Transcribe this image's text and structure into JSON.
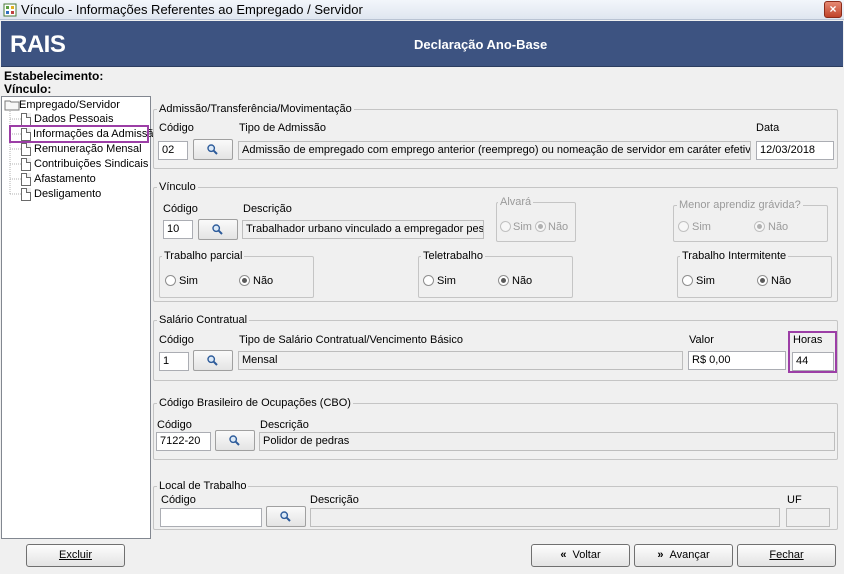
{
  "window": {
    "title": "Vínculo - Informações Referentes ao Empregado / Servidor",
    "close": "×"
  },
  "header": {
    "logo": "RAIS",
    "title": "Declaração Ano-Base"
  },
  "info": {
    "estabelecimento": "Estabelecimento:",
    "vinculo": "Vínculo:"
  },
  "tree": {
    "root": "Empregado/Servidor",
    "items": [
      "Dados Pessoais",
      "Informações da Admissão",
      "Remuneração Mensal",
      "Contribuições Sindicais",
      "Afastamento",
      "Desligamento"
    ],
    "selected": "Informações da Admissão"
  },
  "admissao": {
    "legend": "Admissão/Transferência/Movimentação",
    "codigo_label": "Código",
    "codigo": "02",
    "tipo_label": "Tipo de Admissão",
    "tipo": "Admissão de empregado com emprego anterior (reemprego) ou nomeação de servidor em caráter efetivo ou em comiss",
    "data_label": "Data",
    "data": "12/03/2018"
  },
  "vinculo": {
    "legend": "Vínculo",
    "codigo_label": "Código",
    "codigo": "10",
    "descricao_label": "Descrição",
    "descricao": "Trabalhador urbano vinculado a empregador pessoa jur",
    "alvara": {
      "legend": "Alvará",
      "sim": "Sim",
      "nao": "Não",
      "selected": "nao"
    },
    "menor": {
      "legend": "Menor aprendiz grávida?",
      "sim": "Sim",
      "nao": "Não",
      "selected": "nao"
    },
    "parcial": {
      "legend": "Trabalho parcial",
      "sim": "Sim",
      "nao": "Não",
      "selected": "nao"
    },
    "tele": {
      "legend": "Teletrabalho",
      "sim": "Sim",
      "nao": "Não",
      "selected": "nao"
    },
    "intermitente": {
      "legend": "Trabalho Intermitente",
      "sim": "Sim",
      "nao": "Não",
      "selected": "nao"
    }
  },
  "salario": {
    "legend": "Salário Contratual",
    "codigo_label": "Código",
    "codigo": "1",
    "tipo_label": "Tipo de Salário Contratual/Vencimento Básico",
    "tipo": "Mensal",
    "valor_label": "Valor",
    "valor": "R$ 0,00",
    "horas_label": "Horas",
    "horas": "44"
  },
  "cbo": {
    "legend": "Código Brasileiro de Ocupações (CBO)",
    "codigo_label": "Código",
    "codigo": "7122-20",
    "descricao_label": "Descrição",
    "descricao": "Polidor de pedras"
  },
  "local": {
    "legend": "Local de Trabalho",
    "codigo_label": "Código",
    "codigo": "",
    "descricao_label": "Descrição",
    "descricao": "",
    "uf_label": "UF",
    "uf": ""
  },
  "buttons": {
    "excluir": "Excluir",
    "voltar": "Voltar",
    "avancar": "Avançar",
    "fechar": "Fechar"
  },
  "colors": {
    "header_bg": "#3d5381",
    "highlight": "#9c3ea6"
  }
}
